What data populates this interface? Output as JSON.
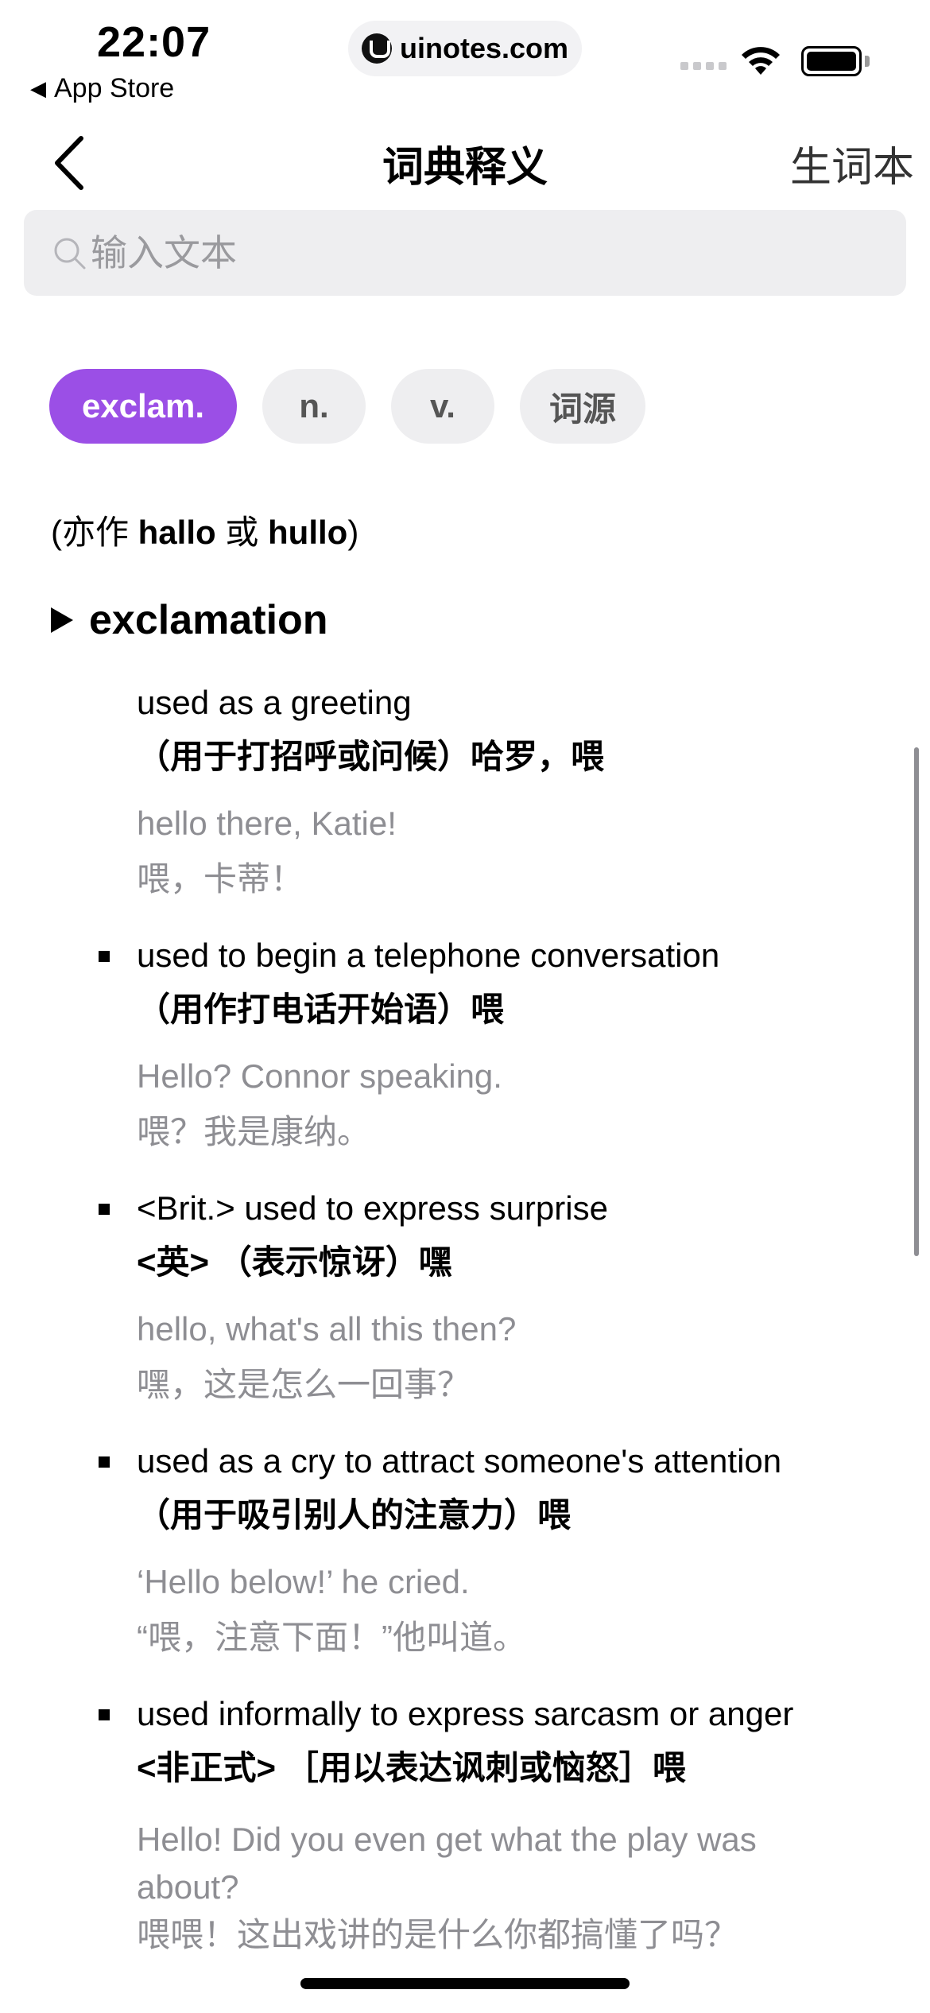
{
  "status": {
    "time": "22:07",
    "back_app": "App Store",
    "url": "uinotes.com"
  },
  "nav": {
    "title": "词典释义",
    "right": "生词本"
  },
  "search": {
    "placeholder": "输入文本"
  },
  "tabs": [
    {
      "label": "exclam.",
      "active": true
    },
    {
      "label": "n.",
      "active": false
    },
    {
      "label": "v.",
      "active": false
    },
    {
      "label": "词源",
      "active": false
    }
  ],
  "alt_forms": {
    "prefix": "(亦作 ",
    "w1": "hallo",
    "mid": " 或 ",
    "w2": "hullo",
    "suffix": ")"
  },
  "pos": {
    "label": "exclamation"
  },
  "senses": [
    {
      "en": "used as a greeting",
      "cn": "（用于打招呼或问候）哈罗，喂",
      "ex_en": "hello there, Katie!",
      "ex_cn": "喂，卡蒂！",
      "bullet": false
    },
    {
      "en": "used to begin a telephone conversation",
      "cn": "（用作打电话开始语）喂",
      "ex_en": "Hello? Connor speaking.",
      "ex_cn": "喂？我是康纳。",
      "bullet": true
    },
    {
      "en": "<Brit.> used to express surprise",
      "cn": "<英> （表示惊讶）嘿",
      "ex_en": "hello, what's all this then?",
      "ex_cn": "嘿，这是怎么一回事？",
      "bullet": true
    },
    {
      "en": "used as a cry to attract someone's attention",
      "cn": "（用于吸引别人的注意力）喂",
      "ex_en": "‘Hello below!’ he cried.",
      "ex_cn": "“喂，注意下面！”他叫道。",
      "bullet": true
    },
    {
      "en": "used informally to express sarcasm or anger",
      "cn": "<非正式> ［用以表达讽刺或恼怒］喂",
      "ex_en": "Hello! Did you even get what the play was about?",
      "ex_cn": "喂喂！这出戏讲的是什么你都搞懂了吗？",
      "bullet": true
    }
  ],
  "colors": {
    "accent": "#9b4fe6",
    "muted": "#8e8e93",
    "chip_bg": "#eeeef0"
  }
}
